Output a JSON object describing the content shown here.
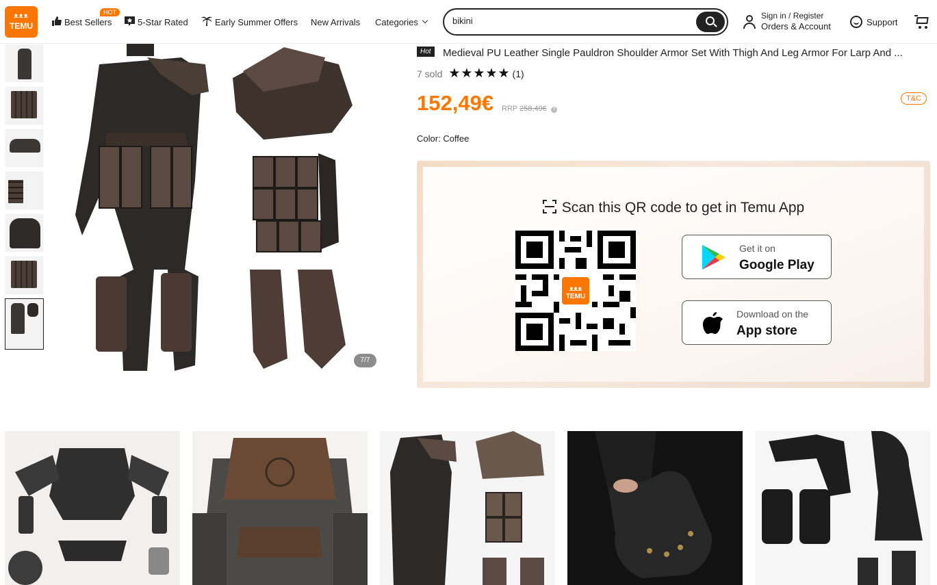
{
  "header": {
    "logo_top": "ᴥᴥᴥ",
    "logo_text": "TEMU",
    "nav": {
      "best_sellers": "Best Sellers",
      "hot_badge": "HOT",
      "five_star": "5-Star Rated",
      "summer_offers": "Early Summer Offers",
      "new_arrivals": "New Arrivals",
      "categories": "Categories"
    },
    "search": {
      "value": "bikini"
    },
    "account": {
      "line1": "Sign in / Register",
      "line2": "Orders & Account"
    },
    "support": "Support"
  },
  "gallery": {
    "counter": "7/7",
    "thumb_count": 7,
    "active_index": 7
  },
  "product": {
    "hot_tag": "Hot",
    "title": "Medieval PU Leather Single Pauldron Shoulder Armor Set With Thigh And Leg Armor For Larp And ...",
    "sold": "7 sold",
    "stars": "★★★★★",
    "rating": 5,
    "rating_count": "(1)",
    "price": "152,49€",
    "rrp_label": "RRP",
    "rrp_price": "258,49€",
    "tc": "T&C",
    "color_label": "Color:",
    "color_value": "Coffee"
  },
  "app_promo": {
    "title": "Scan this QR code to get in Temu App",
    "qr_logo_top": "ᴥᴥᴥ",
    "qr_logo_text": "TEMU",
    "google_play": {
      "small": "Get it on",
      "big": "Google Play"
    },
    "app_store": {
      "small": "Download on the",
      "big": "App store"
    }
  },
  "colors": {
    "brand": "#fb7701",
    "text": "#222222",
    "muted": "#777777"
  }
}
